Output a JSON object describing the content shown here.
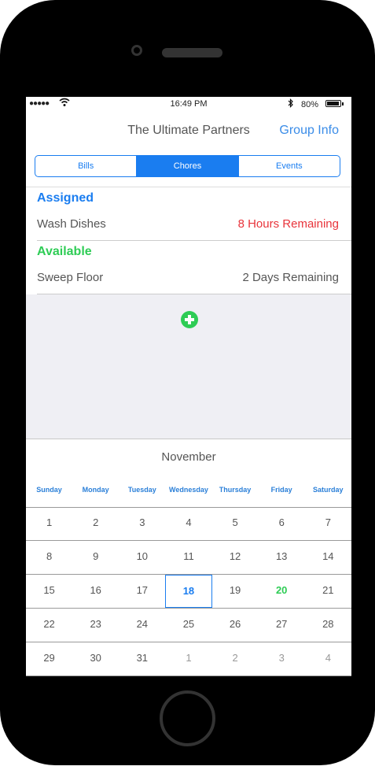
{
  "status": {
    "time": "16:49 PM",
    "battery": "80%"
  },
  "nav": {
    "title": "The Ultimate Partners",
    "group_info": "Group Info"
  },
  "tabs": [
    {
      "label": "Bills"
    },
    {
      "label": "Chores"
    },
    {
      "label": "Events"
    }
  ],
  "active_tab": 1,
  "assigned": {
    "header": "Assigned",
    "items": [
      {
        "name": "Wash Dishes",
        "remaining": "8 Hours Remaining"
      }
    ]
  },
  "available": {
    "header": "Available",
    "items": [
      {
        "name": "Sweep Floor",
        "remaining": "2 Days Remaining"
      }
    ]
  },
  "calendar": {
    "month": "November",
    "weekdays": [
      "Sunday",
      "Monday",
      "Tuesday",
      "Wednesday",
      "Thursday",
      "Friday",
      "Saturday"
    ],
    "weeks": [
      [
        "1",
        "2",
        "3",
        "4",
        "5",
        "6",
        "7"
      ],
      [
        "8",
        "9",
        "10",
        "11",
        "12",
        "13",
        "14"
      ],
      [
        "15",
        "16",
        "17",
        "18",
        "19",
        "20",
        "21"
      ],
      [
        "22",
        "23",
        "24",
        "25",
        "26",
        "27",
        "28"
      ],
      [
        "29",
        "30",
        "31",
        "1",
        "2",
        "3",
        "4"
      ]
    ],
    "today": "18",
    "highlight": "20"
  },
  "colors": {
    "accent": "#1a7df0",
    "green": "#2ecc55",
    "red": "#e8333a"
  }
}
